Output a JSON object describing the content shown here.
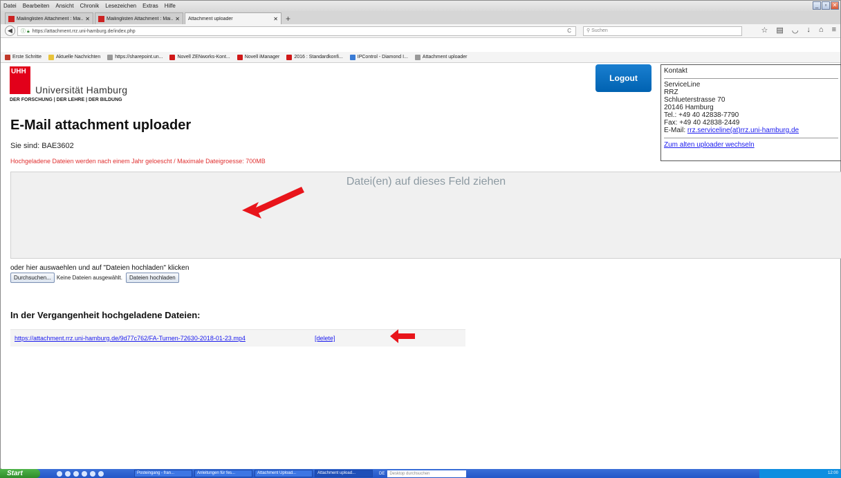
{
  "browser": {
    "menu": [
      "Datei",
      "Bearbeiten",
      "Ansicht",
      "Chronik",
      "Lesezeichen",
      "Extras",
      "Hilfe"
    ],
    "tabs": [
      {
        "label": "Mailinglisten Attachment : Mai..."
      },
      {
        "label": "Mailinglisten Attachment : Mai..."
      },
      {
        "label": "Attachment uploader"
      }
    ],
    "url": "https://attachment.rrz.uni-hamburg.de/index.php",
    "search_placeholder": "Suchen",
    "bookmarks": [
      "Erste Schritte",
      "Aktuelle Nachrichten",
      "https://sharepoint.un...",
      "Novell ZENworks-Kont...",
      "Novell iManager",
      "2016 : Standardkonfi...",
      "IPControl - Diamond I...",
      "Attachment uploader"
    ]
  },
  "page": {
    "logo": {
      "mark": "UHH",
      "name": "Universität Hamburg",
      "tagline": "DER FORSCHUNG | DER LEHRE | DER BILDUNG"
    },
    "logout_label": "Logout",
    "contact": {
      "heading": "Kontakt",
      "org": "ServiceLine",
      "unit": "RRZ",
      "street": "Schlueterstrasse 70",
      "city": "20146 Hamburg",
      "tel": "Tel.: +49 40 42838-7790",
      "fax": "Fax: +49 40 42838-2449",
      "email_prefix": "E-Mail: ",
      "email": "rrz.serviceline(at)rrz.uni-hamburg.de",
      "switch_link": "Zum alten uploader wechseln"
    },
    "title": "E-Mail attachment uploader",
    "user": "Sie sind: BAE3602",
    "notice": "Hochgeladene Dateien werden nach einem Jahr geloescht / Maximale Dateigroesse: 700MB",
    "dropzone_label": "Datei(en) auf dieses Feld ziehen",
    "choose_text": "oder hier auswaehlen und auf \"Dateien hochladen\" klicken",
    "browse_label": "Durchsuchen...",
    "no_file_text": "Keine Dateien ausgewählt.",
    "upload_label": "Dateien hochladen",
    "past_heading": "In der Vergangenheit hochgeladene Dateien:",
    "files": [
      {
        "link": "https://attachment.rrz.uni-hamburg.de/9d77c762/FA-Turnen-72630-2018-01-23.mp4",
        "delete": "[delete]"
      }
    ],
    "annotation_color": "#e8151b"
  },
  "taskbar": {
    "start_label": "Start",
    "tasks": [
      {
        "label": "Posteingang - fran..."
      },
      {
        "label": "Anleitungen für fes..."
      },
      {
        "label": "Attachment Upload..."
      },
      {
        "label": "Attachment upload..."
      }
    ],
    "lang": "DE",
    "search_placeholder": "Desktop durchsuchen",
    "clock": "12:00"
  }
}
